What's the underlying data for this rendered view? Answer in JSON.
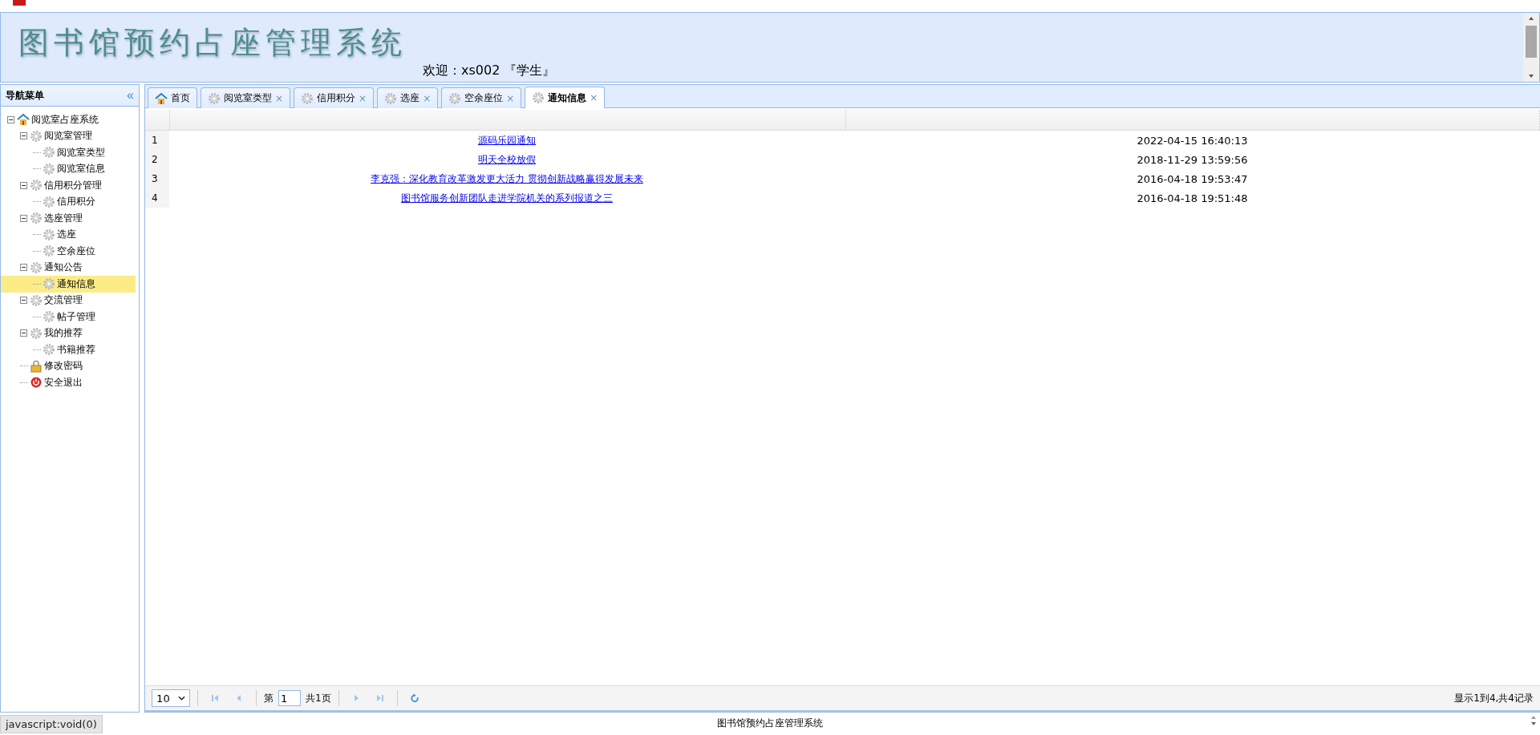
{
  "header": {
    "title": "图书馆预约占座管理系统",
    "welcome": "欢迎：xs002 『学生』"
  },
  "sidebar": {
    "title": "导航菜单",
    "collapse": "«",
    "tree": [
      {
        "label": "阅览室占座系统",
        "kind": "home",
        "expanded": true,
        "selected": false,
        "children": [
          {
            "label": "阅览室管理",
            "kind": "gear",
            "expanded": true,
            "selected": false,
            "children": [
              {
                "label": "阅览室类型",
                "kind": "gear",
                "selected": false
              },
              {
                "label": "阅览室信息",
                "kind": "gear",
                "selected": false
              }
            ]
          },
          {
            "label": "信用积分管理",
            "kind": "gear",
            "expanded": true,
            "selected": false,
            "children": [
              {
                "label": "信用积分",
                "kind": "gear",
                "selected": false
              }
            ]
          },
          {
            "label": "选座管理",
            "kind": "gear",
            "expanded": true,
            "selected": false,
            "children": [
              {
                "label": "选座",
                "kind": "gear",
                "selected": false
              },
              {
                "label": "空余座位",
                "kind": "gear",
                "selected": false
              }
            ]
          },
          {
            "label": "通知公告",
            "kind": "gear",
            "expanded": true,
            "selected": false,
            "children": [
              {
                "label": "通知信息",
                "kind": "gear",
                "selected": true
              }
            ]
          },
          {
            "label": "交流管理",
            "kind": "gear",
            "expanded": true,
            "selected": false,
            "children": [
              {
                "label": "帖子管理",
                "kind": "gear",
                "selected": false
              }
            ]
          },
          {
            "label": "我的推荐",
            "kind": "gear",
            "expanded": true,
            "selected": false,
            "children": [
              {
                "label": "书籍推荐",
                "kind": "gear",
                "selected": false
              }
            ]
          },
          {
            "label": "修改密码",
            "kind": "lock",
            "selected": false
          },
          {
            "label": "安全退出",
            "kind": "exit",
            "selected": false
          }
        ]
      }
    ]
  },
  "tabs": [
    {
      "label": "首页",
      "kind": "home",
      "selected": false,
      "closable": false
    },
    {
      "label": "阅览室类型",
      "kind": "gear",
      "selected": false,
      "closable": true
    },
    {
      "label": "信用积分",
      "kind": "gear",
      "selected": false,
      "closable": true
    },
    {
      "label": "选座",
      "kind": "gear",
      "selected": false,
      "closable": true
    },
    {
      "label": "空余座位",
      "kind": "gear",
      "selected": false,
      "closable": true
    },
    {
      "label": "通知信息",
      "kind": "gear",
      "selected": true,
      "closable": true
    }
  ],
  "close_mark": "×",
  "table": {
    "rows": [
      {
        "number": "1",
        "title": "源码乐园通知",
        "date": "2022-04-15 16:40:13"
      },
      {
        "number": "2",
        "title": "明天全校放假",
        "date": "2018-11-29 13:59:56"
      },
      {
        "number": "3",
        "title": "李克强：深化教育改革激发更大活力 贯彻创新战略赢得发展未来",
        "date": "2016-04-18 19:53:47"
      },
      {
        "number": "4",
        "title": "图书馆服务创新团队走进学院机关的系列报道之三",
        "date": "2016-04-18 19:51:48"
      }
    ]
  },
  "pagination": {
    "page_size": "10",
    "page_label": "第",
    "page": "1",
    "total_pages": "共1页",
    "summary": "显示1到4,共4记录"
  },
  "status_bar": {
    "link": "javascript:void(0)",
    "title": "图书馆预约占座管理系统"
  }
}
